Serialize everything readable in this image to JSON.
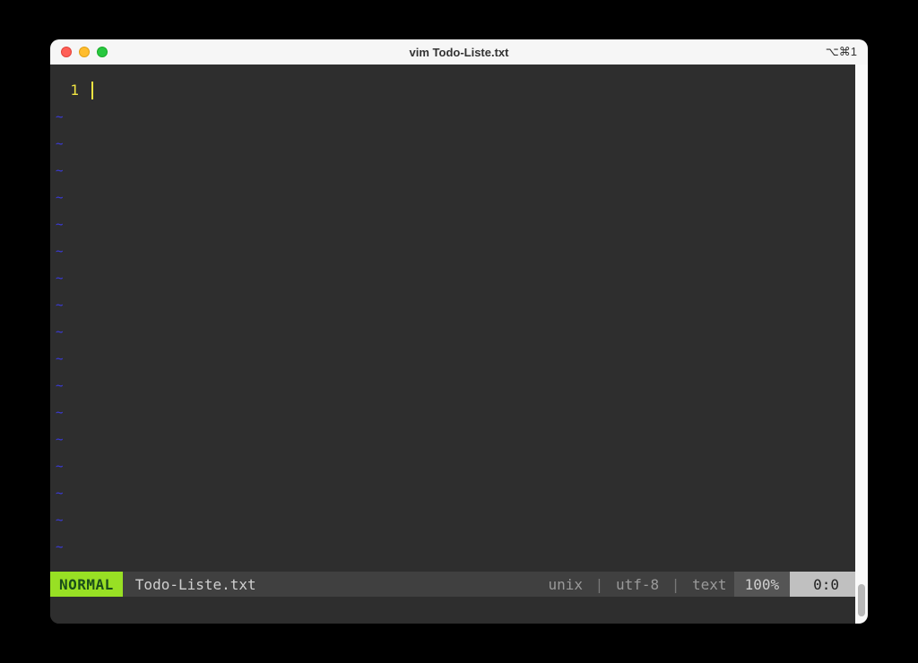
{
  "window": {
    "title": "vim Todo-Liste.txt",
    "shortcut": "⌥⌘1"
  },
  "editor": {
    "line_number": "1",
    "line_content": "",
    "tilde_char": "~",
    "tilde_count": 17
  },
  "statusline": {
    "mode": "NORMAL",
    "filename": "Todo-Liste.txt",
    "fileformat": "unix",
    "encoding": "utf-8",
    "filetype": "text",
    "percent": "100%",
    "position": "0:0",
    "separator": "|"
  },
  "colors": {
    "background": "#2e2e2e",
    "line_number": "#f0e442",
    "tilde": "#3b3bdd",
    "mode_bg": "#98e024",
    "statusbar_bg": "#404040"
  }
}
